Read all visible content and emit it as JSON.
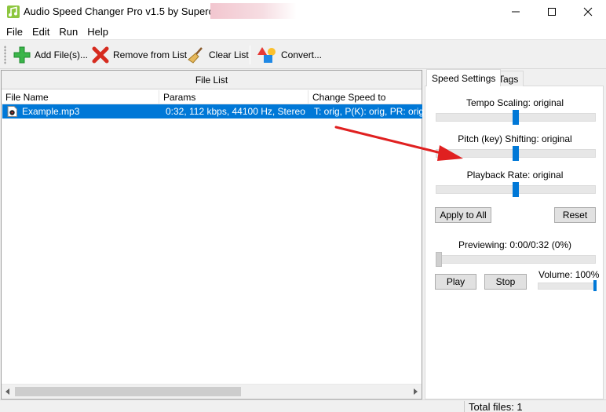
{
  "window": {
    "title": "Audio Speed Changer Pro v1.5 by Supero",
    "controls": {
      "minimize": "minimize-icon",
      "maximize": "maximize-icon",
      "close": "close-icon"
    }
  },
  "menu": [
    "File",
    "Edit",
    "Run",
    "Help"
  ],
  "toolbar": {
    "add_label": "Add File(s)...",
    "remove_label": "Remove from List",
    "clear_label": "Clear List",
    "convert_label": "Convert..."
  },
  "file_list": {
    "caption": "File List",
    "columns": [
      "File Name",
      "Params",
      "Change Speed to"
    ],
    "rows": [
      {
        "name": "Example.mp3",
        "params": "0:32, 112 kbps, 44100 Hz, Stereo",
        "speed": "T: orig, P(K): orig, PR: orig"
      }
    ]
  },
  "tabs": [
    "Speed Settings",
    "Tags"
  ],
  "speed_settings": {
    "tempo_label": "Tempo Scaling: original",
    "tempo_level": 0.5,
    "pitch_label": "Pitch (key) Shifting: original",
    "pitch_level": 0.5,
    "rate_label": "Playback Rate: original",
    "rate_level": 0.5,
    "apply_all": "Apply to All",
    "reset": "Reset",
    "preview_label": "Previewing: 0:00/0:32 (0%)",
    "preview_level": 0,
    "play": "Play",
    "stop": "Stop",
    "volume_label": "Volume: 100%",
    "volume_level": 1.0
  },
  "status": {
    "total_files": "Total files: 1"
  },
  "colors": {
    "accent": "#0078d7",
    "arrow": "#e02020"
  }
}
